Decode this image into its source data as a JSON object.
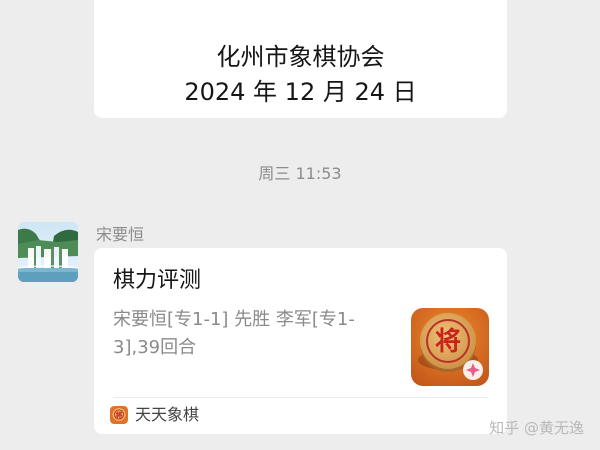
{
  "previous_message": {
    "line1": "化州市象棋协会",
    "line2": "2024 年 12 月 24 日"
  },
  "timestamp": "周三 11:53",
  "sender": {
    "name": "宋要恒",
    "avatar_icon": "waterfall-landscape-avatar"
  },
  "card": {
    "title": "棋力评测",
    "description": "宋要恒[专1-1] 先胜 李军[专1-3],39回合",
    "thumbnail_icon": "xiangqi-jiang-piece-icon",
    "app_name": "天天象棋",
    "app_icon": "tiantian-xiangqi-app-icon"
  },
  "watermark": "知乎 @黄无逸",
  "colors": {
    "background": "#ededed",
    "bubble": "#ffffff",
    "muted_text": "#8c8c8c",
    "piece_red": "#d0261c",
    "piece_wood": "#d79a4a"
  }
}
